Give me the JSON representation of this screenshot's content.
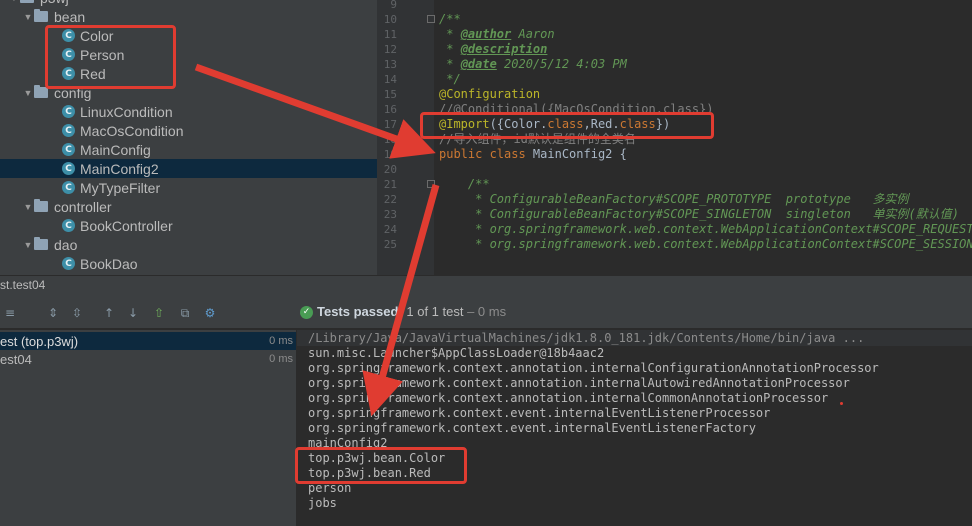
{
  "project_tree": {
    "items": [
      {
        "label": "p3wj",
        "kind": "folder",
        "depth": 1,
        "expanded": true
      },
      {
        "label": "bean",
        "kind": "folder",
        "depth": 2,
        "expanded": true
      },
      {
        "label": "Color",
        "kind": "class",
        "depth": 3
      },
      {
        "label": "Person",
        "kind": "class",
        "depth": 3
      },
      {
        "label": "Red",
        "kind": "class",
        "depth": 3
      },
      {
        "label": "config",
        "kind": "folder",
        "depth": 2,
        "expanded": true
      },
      {
        "label": "LinuxCondition",
        "kind": "class",
        "depth": 3
      },
      {
        "label": "MacOsCondition",
        "kind": "class",
        "depth": 3
      },
      {
        "label": "MainConfig",
        "kind": "class",
        "depth": 3
      },
      {
        "label": "MainConfig2",
        "kind": "class",
        "depth": 3,
        "selected": true
      },
      {
        "label": "MyTypeFilter",
        "kind": "class",
        "depth": 3
      },
      {
        "label": "controller",
        "kind": "folder",
        "depth": 2,
        "expanded": true
      },
      {
        "label": "BookController",
        "kind": "class",
        "depth": 3
      },
      {
        "label": "dao",
        "kind": "folder",
        "depth": 2,
        "expanded": true
      },
      {
        "label": "BookDao",
        "kind": "class",
        "depth": 3
      }
    ],
    "class_icon_letter": "C"
  },
  "editor": {
    "lines": [
      {
        "n": "9",
        "segs": []
      },
      {
        "n": "10",
        "segs": [
          {
            "t": "/**",
            "c": "c-doc"
          }
        ]
      },
      {
        "n": "11",
        "segs": [
          {
            "t": " * ",
            "c": "c-doc"
          },
          {
            "t": "@author",
            "c": "c-tag"
          },
          {
            "t": " Aaron",
            "c": "c-doc"
          }
        ]
      },
      {
        "n": "12",
        "segs": [
          {
            "t": " * ",
            "c": "c-doc"
          },
          {
            "t": "@description",
            "c": "c-tag"
          }
        ]
      },
      {
        "n": "13",
        "segs": [
          {
            "t": " * ",
            "c": "c-doc"
          },
          {
            "t": "@date",
            "c": "c-tag"
          },
          {
            "t": " 2020/5/12 4:03 PM",
            "c": "c-doc"
          }
        ]
      },
      {
        "n": "14",
        "segs": [
          {
            "t": " */",
            "c": "c-doc"
          }
        ]
      },
      {
        "n": "15",
        "segs": [
          {
            "t": "@Configuration",
            "c": "c-ann"
          }
        ]
      },
      {
        "n": "16",
        "segs": [
          {
            "t": "//@Conditional({MacOsCondition.class})",
            "c": "c-cmt"
          }
        ]
      },
      {
        "n": "17",
        "segs": [
          {
            "t": "@Import",
            "c": "c-ann"
          },
          {
            "t": "({Color.",
            "c": "c-txt"
          },
          {
            "t": "class",
            "c": "c-kw"
          },
          {
            "t": ",Red.",
            "c": "c-txt"
          },
          {
            "t": "class",
            "c": "c-kw"
          },
          {
            "t": "})",
            "c": "c-txt"
          }
        ]
      },
      {
        "n": "18",
        "segs": [
          {
            "t": "//导入组件，id默认是组件的全类名",
            "c": "c-cmt"
          }
        ]
      },
      {
        "n": "19",
        "segs": [
          {
            "t": "public class ",
            "c": "c-kw"
          },
          {
            "t": "MainConfig2 {",
            "c": "c-txt"
          }
        ]
      },
      {
        "n": "20",
        "segs": []
      },
      {
        "n": "21",
        "segs": [
          {
            "t": "    /**",
            "c": "c-doc"
          }
        ]
      },
      {
        "n": "22",
        "segs": [
          {
            "t": "     * ConfigurableBeanFactory#SCOPE_PROTOTYPE  prototype   多实例",
            "c": "c-doc"
          }
        ]
      },
      {
        "n": "23",
        "segs": [
          {
            "t": "     * ConfigurableBeanFactory#SCOPE_SINGLETON  singleton   单实例(默认值)",
            "c": "c-doc"
          }
        ]
      },
      {
        "n": "24",
        "segs": [
          {
            "t": "     * org.springframework.web.context.WebApplicationContext#SCOPE_REQUEST",
            "c": "c-doc"
          }
        ]
      },
      {
        "n": "25",
        "segs": [
          {
            "t": "     * org.springframework.web.context.WebApplicationContext#SCOPE_SESSION",
            "c": "c-doc"
          }
        ]
      }
    ]
  },
  "run_window": {
    "tab_label": "st.test04",
    "status_prefix": "Tests passed:",
    "status_count": "1 of 1 test",
    "status_time": "– 0 ms",
    "tests": [
      {
        "name": "est (top.p3wj)",
        "time": "0 ms",
        "selected": true
      },
      {
        "name": "est04",
        "time": "0 ms",
        "selected": false
      }
    ],
    "console_lines": [
      "/Library/Java/JavaVirtualMachines/jdk1.8.0_181.jdk/Contents/Home/bin/java ...",
      "sun.misc.Launcher$AppClassLoader@18b4aac2",
      "org.springframework.context.annotation.internalConfigurationAnnotationProcessor",
      "org.springframework.context.annotation.internalAutowiredAnnotationProcessor",
      "org.springframework.context.annotation.internalCommonAnnotationProcessor",
      "org.springframework.context.event.internalEventListenerProcessor",
      "org.springframework.context.event.internalEventListenerFactory",
      "mainConfig2",
      "top.p3wj.bean.Color",
      "top.p3wj.bean.Red",
      "person",
      "jobs"
    ]
  },
  "toolbar_icons": [
    "rerun-icon",
    "stop-icon",
    "sort-icon",
    "expand-icon",
    "collapse-icon",
    "prev-icon",
    "next-icon",
    "export-icon",
    "history-icon",
    "settings-icon"
  ],
  "colors": {
    "annotation_red": "#e03c31",
    "selection": "#0d293e",
    "pass_green": "#499c54"
  }
}
